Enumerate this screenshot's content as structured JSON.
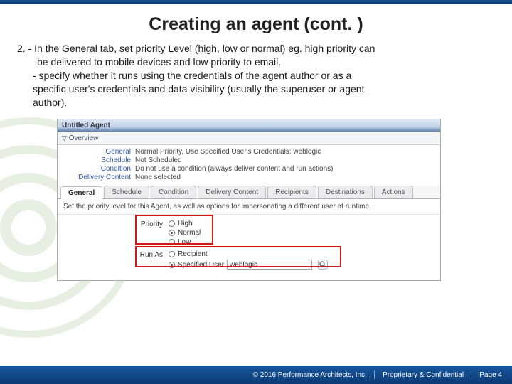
{
  "slide": {
    "title": "Creating an agent (cont. )",
    "bullet_num": "2.",
    "line1": " - In the General tab, set priority Level (high, low or normal) eg. high priority can",
    "line2": "be delivered to  mobile devices and low priority to email.",
    "line3": "- specify whether it runs using the credentials of the agent author or as a",
    "line4": "specific user's credentials and data visibility (usually the superuser or agent",
    "line5": "author)."
  },
  "screenshot": {
    "window_title": "Untitled Agent",
    "overview_label": "Overview",
    "overview": {
      "general_l": "General",
      "general_v": "Normal Priority, Use Specified User's Credentials: weblogic",
      "schedule_l": "Schedule",
      "schedule_v": "Not Scheduled",
      "condition_l": "Condition",
      "condition_v": "Do not use a condition (always deliver content and run actions)",
      "delivery_l": "Delivery Content",
      "delivery_v": "None selected"
    },
    "tabs": [
      "General",
      "Schedule",
      "Condition",
      "Delivery Content",
      "Recipients",
      "Destinations",
      "Actions"
    ],
    "tab_note": "Set the priority level for this Agent, as well as options for impersonating a different user at runtime.",
    "priority": {
      "label": "Priority",
      "opts": [
        "High",
        "Normal",
        "Low"
      ],
      "selected": "Normal"
    },
    "runas": {
      "label": "Run As",
      "opts": [
        "Recipient",
        "Specified User"
      ],
      "selected": "Specified User",
      "value": "weblogic"
    }
  },
  "footer": {
    "copyright": "© 2016 Performance Architects, Inc.",
    "conf": "Proprietary & Confidential",
    "page": "Page 4"
  }
}
